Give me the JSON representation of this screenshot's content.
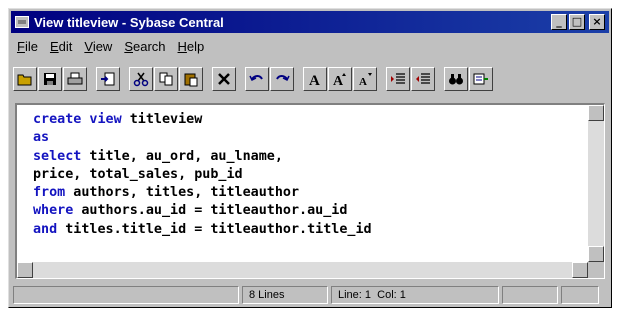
{
  "window": {
    "title": "View titleview - Sybase Central"
  },
  "controls": {
    "minimize": "_",
    "maximize": "□",
    "close": "×"
  },
  "menu": [
    {
      "label": "File",
      "mnemonic": "F",
      "rest": "ile"
    },
    {
      "label": "Edit",
      "mnemonic": "E",
      "rest": "dit"
    },
    {
      "label": "View",
      "mnemonic": "V",
      "rest": "iew"
    },
    {
      "label": "Search",
      "mnemonic": "S",
      "rest": "earch"
    },
    {
      "label": "Help",
      "mnemonic": "H",
      "rest": "elp"
    }
  ],
  "toolbar": {
    "icons": [
      "open-icon",
      "save-icon",
      "print-icon",
      "import-icon",
      "cut-icon",
      "copy-icon",
      "paste-icon",
      "delete-icon",
      "undo-icon",
      "redo-icon",
      "font-icon",
      "font-larger-icon",
      "font-smaller-icon",
      "indent-icon",
      "outdent-icon",
      "find-icon",
      "run-icon"
    ],
    "font_glyph": "A"
  },
  "editor": {
    "lines": [
      [
        {
          "t": "create view",
          "kw": true
        },
        {
          "t": " titleview",
          "kw": false
        }
      ],
      [
        {
          "t": "as",
          "kw": true
        }
      ],
      [
        {
          "t": "select",
          "kw": true
        },
        {
          "t": " title, au_ord, au_lname,",
          "kw": false
        }
      ],
      [
        {
          "t": "price, total_sales, pub_id",
          "kw": false
        }
      ],
      [
        {
          "t": "from",
          "kw": true
        },
        {
          "t": " authors, titles, titleauthor",
          "kw": false
        }
      ],
      [
        {
          "t": "where",
          "kw": true
        },
        {
          "t": " authors.au_id = titleauthor.au_id",
          "kw": false
        }
      ],
      [
        {
          "t": "and",
          "kw": true
        },
        {
          "t": " titles.title_id = titleauthor.title_id",
          "kw": false
        }
      ]
    ]
  },
  "status": {
    "lines": "8 Lines",
    "line": "Line: 1",
    "col": "Col: 1"
  },
  "colors": {
    "title_bar": "#000080",
    "keyword": "#1414c0",
    "chrome": "#c0c0c0"
  }
}
